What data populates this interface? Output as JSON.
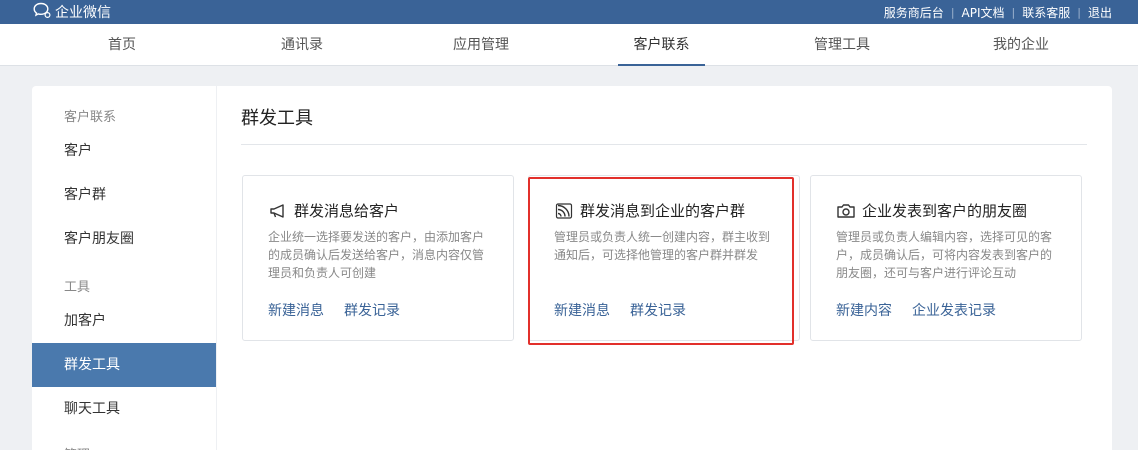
{
  "topbar": {
    "logo_text": "企业微信",
    "links": [
      "服务商后台",
      "API文档",
      "联系客服",
      "退出"
    ],
    "separator": "|",
    "bg_color": "#3a6397"
  },
  "nav": {
    "items": [
      {
        "label": "首页",
        "active": false
      },
      {
        "label": "通讯录",
        "active": false
      },
      {
        "label": "应用管理",
        "active": false
      },
      {
        "label": "客户联系",
        "active": true
      },
      {
        "label": "管理工具",
        "active": false
      },
      {
        "label": "我的企业",
        "active": false
      }
    ]
  },
  "sidebar": {
    "sections": [
      {
        "title": "客户联系",
        "items": [
          {
            "label": "客户"
          },
          {
            "label": "客户群"
          },
          {
            "label": "客户朋友圈"
          }
        ]
      },
      {
        "title": "工具",
        "items": [
          {
            "label": "加客户"
          },
          {
            "label": "群发工具",
            "active": true
          },
          {
            "label": "聊天工具"
          }
        ]
      },
      {
        "title": "管理"
      }
    ]
  },
  "main": {
    "title": "群发工具",
    "cards": [
      {
        "icon": "megaphone-icon",
        "title": "群发消息给客户",
        "desc": "企业统一选择要发送的客户，由添加客户的成员确认后发送给客户，消息内容仅管理员和负责人可创建",
        "links": [
          "新建消息",
          "群发记录"
        ]
      },
      {
        "icon": "broadcast-icon",
        "title": "群发消息到企业的客户群",
        "desc": "管理员或负责人统一创建内容，群主收到通知后，可选择他管理的客户群并群发",
        "links": [
          "新建消息",
          "群发记录"
        ],
        "highlighted": true
      },
      {
        "icon": "camera-icon",
        "title": "企业发表到客户的朋友圈",
        "desc": "管理员或负责人编辑内容，选择可见的客户，成员确认后，可将内容发表到客户的朋友圈，还可与客户进行评论互动",
        "links": [
          "新建内容",
          "企业发表记录"
        ]
      }
    ],
    "highlight_color": "#e2302b"
  }
}
